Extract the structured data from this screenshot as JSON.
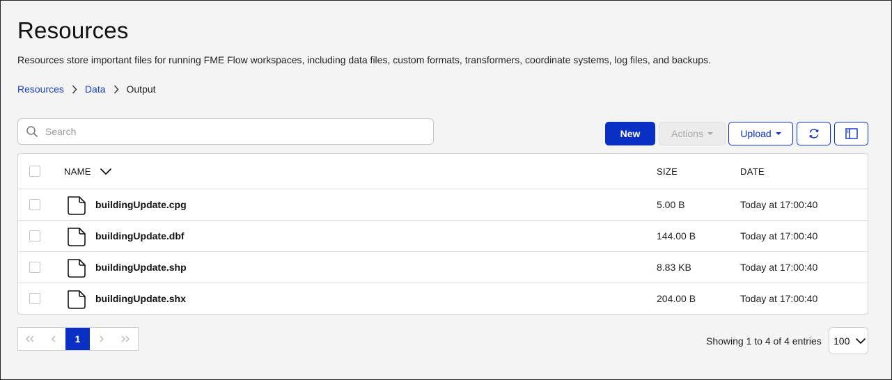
{
  "page": {
    "title": "Resources",
    "description": "Resources store important files for running FME Flow workspaces, including data files, custom formats, transformers, coordinate systems, log files, and backups."
  },
  "breadcrumb": [
    "Resources",
    "Data",
    "Output"
  ],
  "search": {
    "placeholder": "Search",
    "value": ""
  },
  "toolbar": {
    "new_label": "New",
    "actions_label": "Actions",
    "upload_label": "Upload",
    "refresh_icon": "refresh-icon",
    "panel_icon": "panel-toggle-icon"
  },
  "table": {
    "headers": {
      "name": "NAME",
      "size": "SIZE",
      "date": "DATE"
    },
    "rows": [
      {
        "name": "buildingUpdate.cpg",
        "size": "5.00 B",
        "date": "Today at 17:00:40"
      },
      {
        "name": "buildingUpdate.dbf",
        "size": "144.00 B",
        "date": "Today at 17:00:40"
      },
      {
        "name": "buildingUpdate.shp",
        "size": "8.83 KB",
        "date": "Today at 17:00:40"
      },
      {
        "name": "buildingUpdate.shx",
        "size": "204.00 B",
        "date": "Today at 17:00:40"
      }
    ]
  },
  "pagination": {
    "first": "«",
    "prev": "‹",
    "current_page": "1",
    "next": "›",
    "last": "»",
    "showing": "Showing 1 to 4 of 4 entries",
    "page_size": "100"
  },
  "colors": {
    "accent": "#0a2fc4",
    "link": "#1b3fbf",
    "background": "#f4f4f4"
  }
}
